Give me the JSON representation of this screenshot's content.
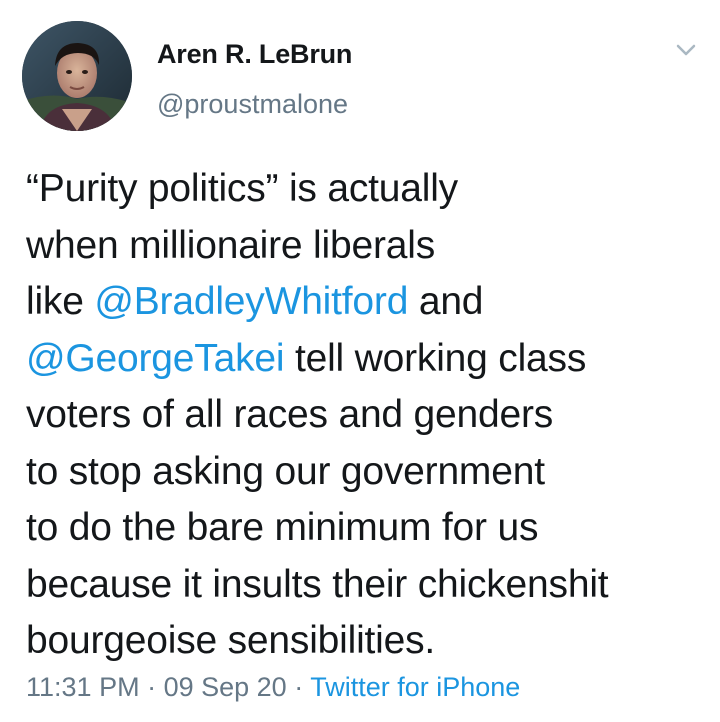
{
  "author": {
    "display_name": "Aren R. LeBrun",
    "handle": "@proustmalone",
    "avatar_icon": "user-avatar-photo"
  },
  "menu": {
    "icon": "chevron-down-icon"
  },
  "tweet": {
    "lines": [
      [
        {
          "text": "“Purity politics” is actually",
          "type": "text"
        }
      ],
      [
        {
          "text": "when millionaire liberals",
          "type": "text"
        }
      ],
      [
        {
          "text": "like ",
          "type": "text"
        },
        {
          "text": "@BradleyWhitford",
          "type": "mention"
        },
        {
          "text": " and",
          "type": "text"
        }
      ],
      [
        {
          "text": "@GeorgeTakei",
          "type": "mention"
        },
        {
          "text": " tell working class",
          "type": "text"
        }
      ],
      [
        {
          "text": "voters of all races and genders",
          "type": "text"
        }
      ],
      [
        {
          "text": "to stop asking our government",
          "type": "text"
        }
      ],
      [
        {
          "text": "to do the bare minimum for us",
          "type": "text"
        }
      ],
      [
        {
          "text": "because it insults their chickenshit",
          "type": "text"
        }
      ],
      [
        {
          "text": "bourgeoise sensibilities.",
          "type": "text"
        }
      ]
    ]
  },
  "meta": {
    "time": "11:31 PM",
    "separator": " · ",
    "date": "09 Sep 20",
    "source": "Twitter for iPhone"
  },
  "colors": {
    "text": "#14171a",
    "secondary": "#657786",
    "link": "#1b95e0",
    "background": "#ffffff"
  }
}
